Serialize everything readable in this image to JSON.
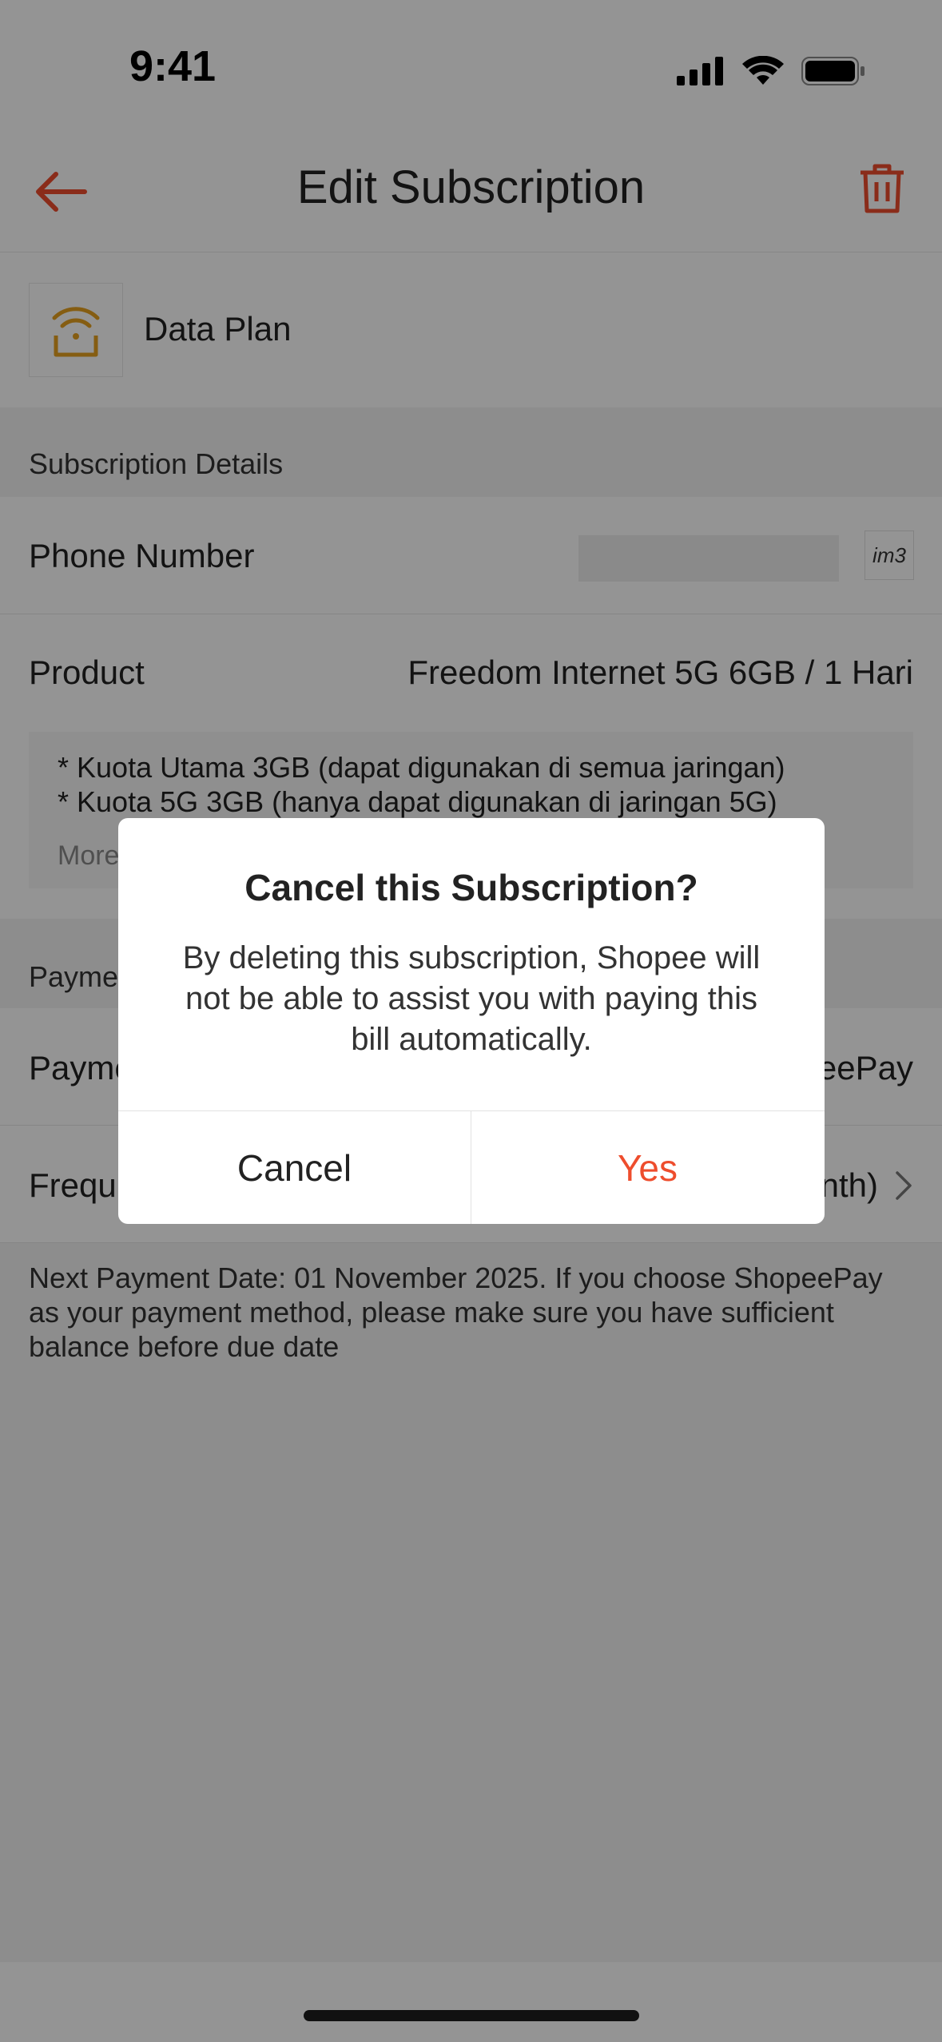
{
  "status_bar": {
    "time": "9:41"
  },
  "header": {
    "title": "Edit Subscription"
  },
  "plan": {
    "label": "Data Plan"
  },
  "subscription_details": {
    "section_title": "Subscription Details",
    "phone_label": "Phone Number",
    "operator_logo_text": "im3",
    "product_label": "Product",
    "product_value": "Freedom Internet 5G 6GB / 1 Hari",
    "description_lines": [
      "* Kuota Utama 3GB (dapat digunakan di semua jaringan)",
      "* Kuota 5G 3GB (hanya dapat digunakan di jaringan 5G)"
    ],
    "more_label": "More"
  },
  "payment": {
    "section_title": "Payme",
    "method_label": "Payme",
    "method_value": "eePay",
    "frequency_label": "Frequ",
    "frequency_value": "nth)"
  },
  "note": "Next Payment Date: 01 November 2025. If you choose ShopeePay as your payment method, please make sure you have sufficient balance before due date",
  "dialog": {
    "title": "Cancel this Subscription?",
    "message": "By deleting this subscription, Shopee will not be able to assist you with paying this bill automatically.",
    "cancel_label": "Cancel",
    "yes_label": "Yes"
  },
  "colors": {
    "accent": "#ee4d2d",
    "plan_icon": "#e6a020"
  },
  "icons": [
    "back-arrow-icon",
    "trash-icon",
    "wifi-router-icon",
    "chevron-right-icon",
    "signal-icon",
    "wifi-icon",
    "battery-icon"
  ]
}
